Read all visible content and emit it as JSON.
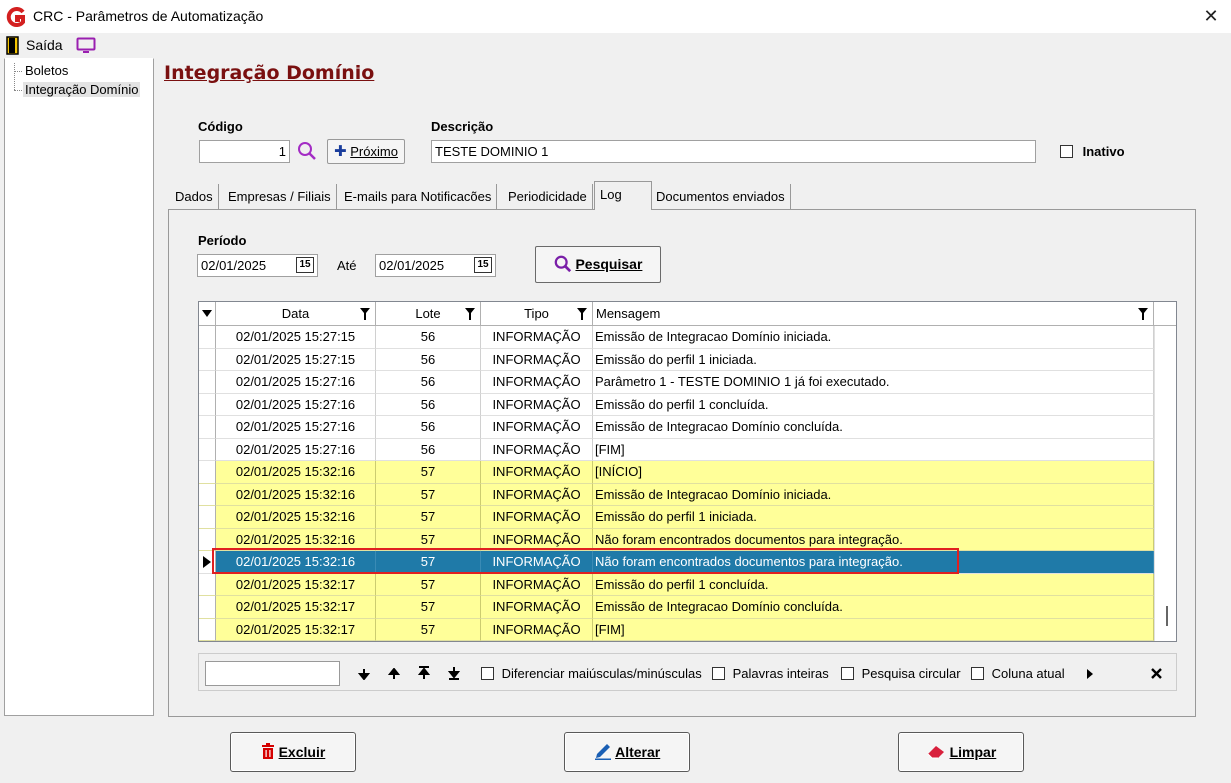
{
  "window": {
    "title": "CRC - Parâmetros de Automatização",
    "close": "✕"
  },
  "menu": {
    "exit_label": "Saída"
  },
  "sidebar": {
    "items": [
      {
        "label": "Boletos"
      },
      {
        "label": "Integração Domínio"
      }
    ]
  },
  "page_title": "Integração Domínio",
  "form": {
    "codigo_label": "Código",
    "codigo_value": "1",
    "proximo_label": "Próximo",
    "descricao_label": "Descrição",
    "descricao_value": "TESTE DOMINIO 1",
    "inativo_label": "Inativo"
  },
  "tabs": [
    {
      "label": "Dados"
    },
    {
      "label": "Empresas / Filiais"
    },
    {
      "label": "E-mails para Notificacões"
    },
    {
      "label": "Periodicidade"
    },
    {
      "label": "Log"
    },
    {
      "label": "Documentos enviados"
    }
  ],
  "log": {
    "periodo_label": "Período",
    "ate_label": "Até",
    "date_from": "02/01/2025",
    "date_to": "02/01/2025",
    "pesquisar_label": "Pesquisar",
    "calendar_glyph": "15"
  },
  "grid": {
    "columns": [
      "Data",
      "Lote",
      "Tipo",
      "Mensagem"
    ],
    "rows": [
      {
        "data": "02/01/2025 15:27:15",
        "lote": "56",
        "tipo": "INFORMAÇÃO",
        "msg": "Emissão de Integracao Domínio iniciada."
      },
      {
        "data": "02/01/2025 15:27:15",
        "lote": "56",
        "tipo": "INFORMAÇÃO",
        "msg": "Emissão do perfil 1 iniciada."
      },
      {
        "data": "02/01/2025 15:27:16",
        "lote": "56",
        "tipo": "INFORMAÇÃO",
        "msg": "Parâmetro 1 - TESTE DOMINIO 1 já foi executado."
      },
      {
        "data": "02/01/2025 15:27:16",
        "lote": "56",
        "tipo": "INFORMAÇÃO",
        "msg": "Emissão do perfil 1 concluída."
      },
      {
        "data": "02/01/2025 15:27:16",
        "lote": "56",
        "tipo": "INFORMAÇÃO",
        "msg": "Emissão de Integracao Domínio concluída."
      },
      {
        "data": "02/01/2025 15:27:16",
        "lote": "56",
        "tipo": "INFORMAÇÃO",
        "msg": "[FIM]"
      },
      {
        "data": "02/01/2025 15:32:16",
        "lote": "57",
        "tipo": "INFORMAÇÃO",
        "msg": "[INÍCIO]"
      },
      {
        "data": "02/01/2025 15:32:16",
        "lote": "57",
        "tipo": "INFORMAÇÃO",
        "msg": "Emissão de Integracao Domínio iniciada."
      },
      {
        "data": "02/01/2025 15:32:16",
        "lote": "57",
        "tipo": "INFORMAÇÃO",
        "msg": "Emissão do perfil 1 iniciada."
      },
      {
        "data": "02/01/2025 15:32:16",
        "lote": "57",
        "tipo": "INFORMAÇÃO",
        "msg": "Não foram encontrados documentos para integração."
      },
      {
        "data": "02/01/2025 15:32:16",
        "lote": "57",
        "tipo": "INFORMAÇÃO",
        "msg": "Não foram encontrados documentos para integração."
      },
      {
        "data": "02/01/2025 15:32:17",
        "lote": "57",
        "tipo": "INFORMAÇÃO",
        "msg": "Emissão do perfil 1 concluída."
      },
      {
        "data": "02/01/2025 15:32:17",
        "lote": "57",
        "tipo": "INFORMAÇÃO",
        "msg": "Emissão de Integracao Domínio concluída."
      },
      {
        "data": "02/01/2025 15:32:17",
        "lote": "57",
        "tipo": "INFORMAÇÃO",
        "msg": "[FIM]"
      }
    ]
  },
  "search": {
    "case_label": "Diferenciar maiúsculas/minúsculas",
    "words_label": "Palavras inteiras",
    "circular_label": "Pesquisa circular",
    "column_label": "Coluna atual"
  },
  "buttons": {
    "excluir": "Excluir",
    "alterar": "Alterar",
    "limpar": "Limpar"
  },
  "colors": {
    "title": "#7a1010",
    "highlight": "#ffff99",
    "selected": "#1f7aa8",
    "accent": "#8b1a9b"
  }
}
